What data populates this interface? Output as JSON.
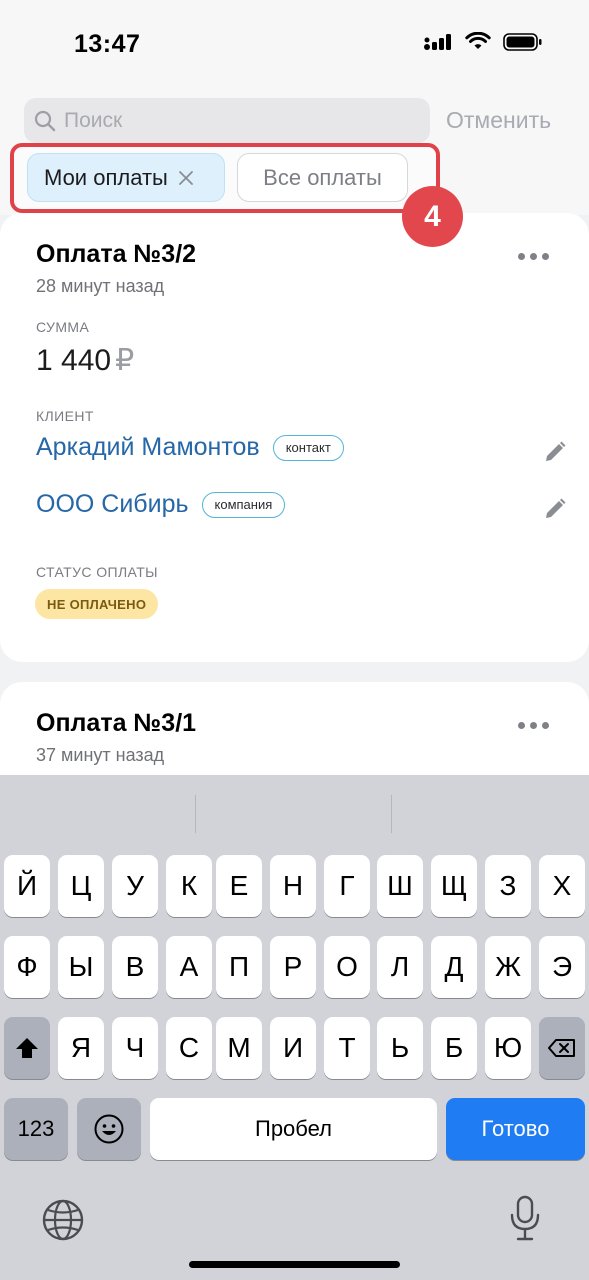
{
  "status_bar": {
    "time": "13:47"
  },
  "search": {
    "placeholder": "Поиск",
    "value": "",
    "cancel_label": "Отменить"
  },
  "filters": {
    "mine_label": "Мои оплаты",
    "all_label": "Все оплаты",
    "step_number": "4",
    "highlight_color": "#e0424a"
  },
  "payments": [
    {
      "title": "Оплата №3/2",
      "time": "28 минут назад",
      "amount_label": "СУММА",
      "amount": "1 440",
      "currency": "₽",
      "client_label": "КЛИЕНТ",
      "clients": [
        {
          "name": "Аркадий Мамонтов",
          "tag": "контакт"
        },
        {
          "name": "ООО Сибирь",
          "tag": "компания"
        }
      ],
      "status_label": "СТАТУС ОПЛАТЫ",
      "status": "НЕ ОПЛАЧЕНО",
      "status_color": "#fde6a3"
    },
    {
      "title": "Оплата №3/1",
      "time": "37 минут назад"
    }
  ],
  "keyboard": {
    "row1": [
      "Й",
      "Ц",
      "У",
      "К",
      "Е",
      "Н",
      "Г",
      "Ш",
      "Щ",
      "З",
      "Х"
    ],
    "row2": [
      "Ф",
      "Ы",
      "В",
      "А",
      "П",
      "Р",
      "О",
      "Л",
      "Д",
      "Ж",
      "Э"
    ],
    "row3": [
      "Я",
      "Ч",
      "С",
      "М",
      "И",
      "Т",
      "Ь",
      "Б",
      "Ю"
    ],
    "numbers_label": "123",
    "space_label": "Пробел",
    "done_label": "Готово",
    "done_color": "#1f7cf3"
  }
}
